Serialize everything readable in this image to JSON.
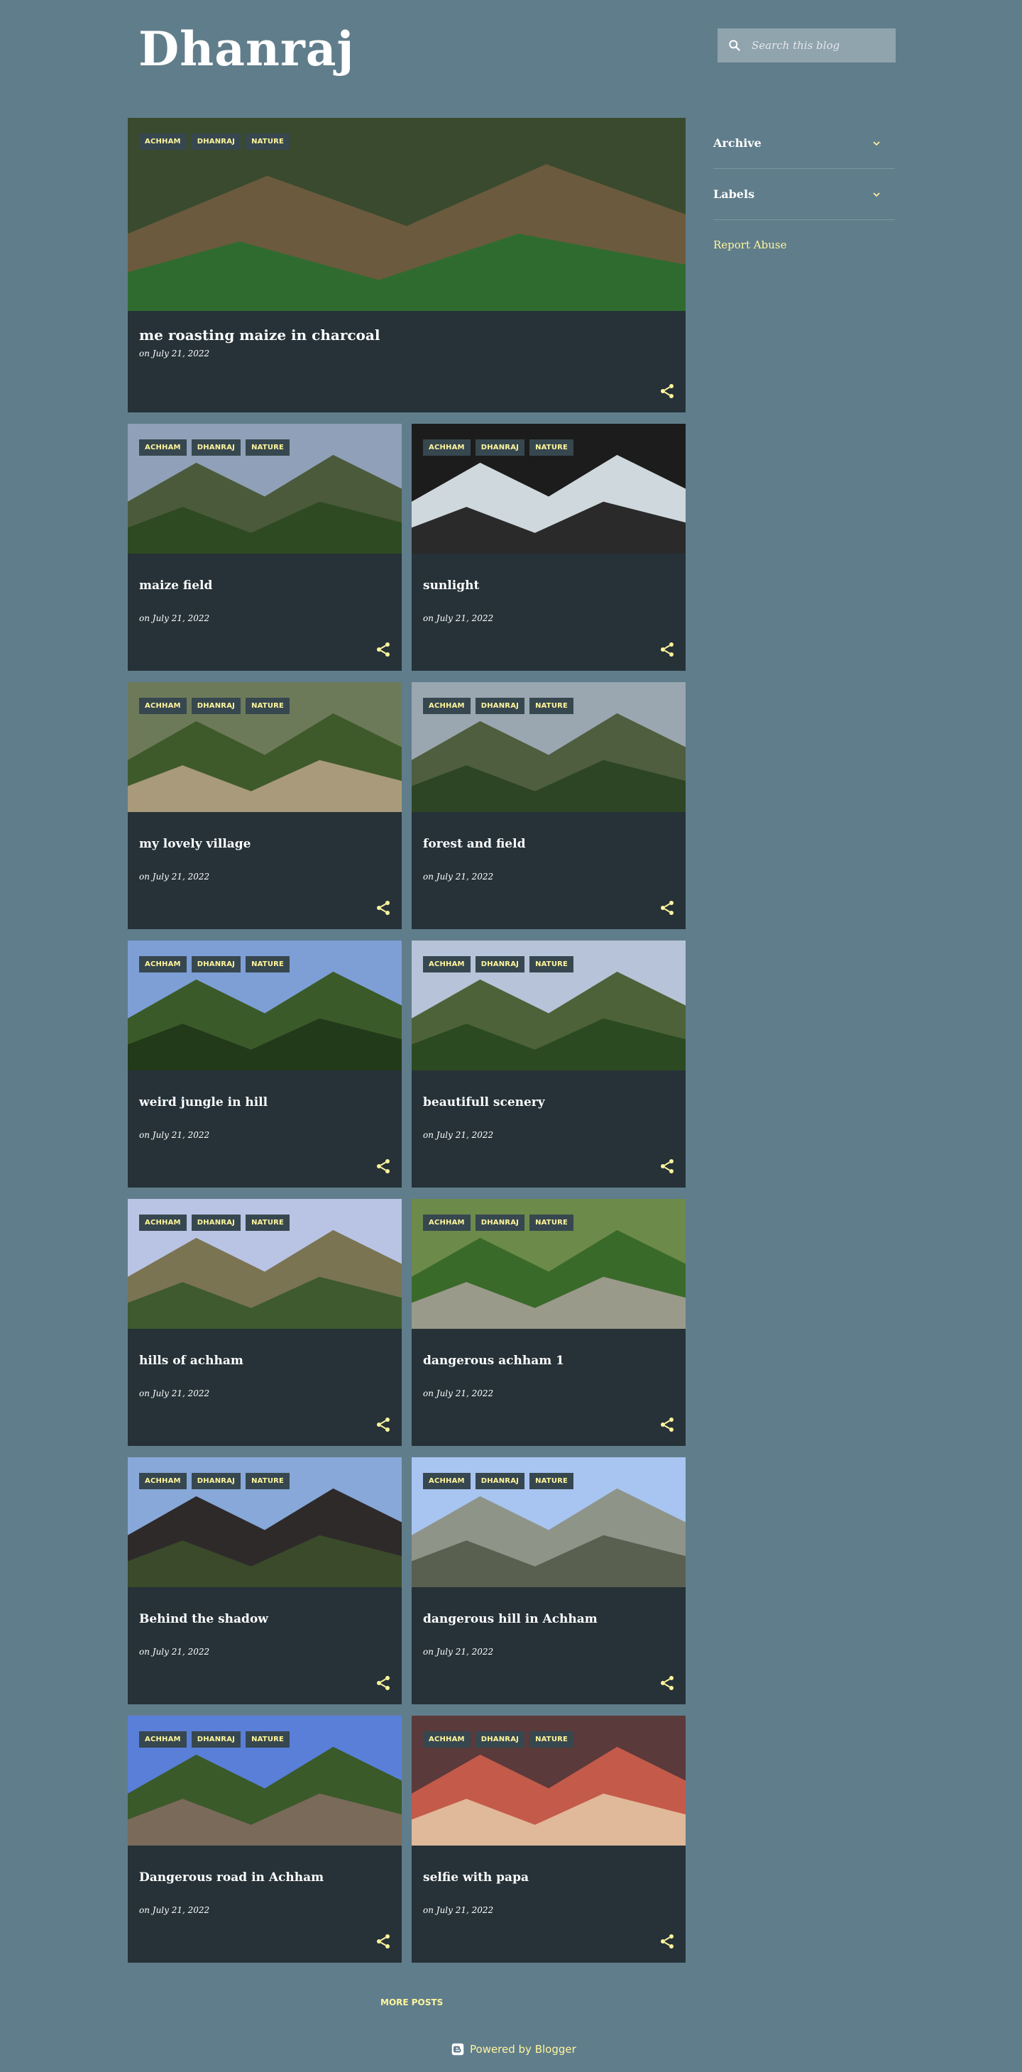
{
  "header": {
    "title": "Dhanraj"
  },
  "search": {
    "placeholder": "Search this blog"
  },
  "sidebar": {
    "widgets": [
      {
        "label": "Archive"
      },
      {
        "label": "Labels"
      }
    ],
    "report_abuse": "Report Abuse"
  },
  "post_labels": [
    "ACHHAM",
    "DHANRAJ",
    "NATURE"
  ],
  "featured": {
    "title": "me roasting maize in charcoal",
    "date": "on July 21, 2022"
  },
  "posts": [
    {
      "title": "maize field",
      "date": "on July 21, 2022"
    },
    {
      "title": "sunlight",
      "date": "on July 21, 2022"
    },
    {
      "title": "my lovely village",
      "date": "on July 21, 2022"
    },
    {
      "title": "forest and field",
      "date": "on July 21, 2022"
    },
    {
      "title": "weird jungle in hill",
      "date": "on July 21, 2022"
    },
    {
      "title": "beautifull scenery",
      "date": "on July 21, 2022"
    },
    {
      "title": "hills of achham",
      "date": "on July 21, 2022"
    },
    {
      "title": "dangerous achham 1",
      "date": "on July 21, 2022"
    },
    {
      "title": "Behind the shadow",
      "date": "on July 21, 2022"
    },
    {
      "title": "dangerous hill in Achham",
      "date": "on July 21, 2022"
    },
    {
      "title": "Dangerous road in Achham",
      "date": "on July 21, 2022"
    },
    {
      "title": "selfie with papa",
      "date": "on July 21, 2022"
    }
  ],
  "footer": {
    "more_posts": "MORE POSTS",
    "powered_by": "Powered by Blogger"
  },
  "colors": {
    "background": "#607d8b",
    "card": "#263238",
    "accent": "#fff59d",
    "chip": "#37474f"
  }
}
